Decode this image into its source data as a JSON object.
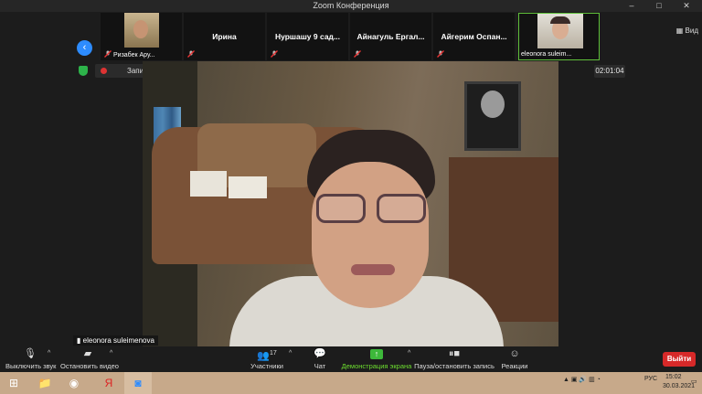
{
  "window": {
    "title": "Zoom Конференция",
    "controls": {
      "minimize": "–",
      "maximize": "□",
      "close": "✕"
    }
  },
  "gallery": {
    "view_label": "Вид",
    "tiles": [
      {
        "name": "Ризабек Ару...",
        "muted": true,
        "has_video": true
      },
      {
        "name": "Ирина",
        "muted": true,
        "has_video": false
      },
      {
        "name": "Нуршашу 9 сад...",
        "muted": true,
        "has_video": false
      },
      {
        "name": "Айнагуль Ергал...",
        "muted": true,
        "has_video": false
      },
      {
        "name": "Айгерим Оспан...",
        "muted": true,
        "has_video": false
      },
      {
        "name": "eleonora suleim...",
        "muted": false,
        "has_video": true
      }
    ]
  },
  "recording": {
    "label": "Запись...",
    "timer": "02:01:04"
  },
  "speaker": {
    "name": "eleonora suleimenova"
  },
  "toolbar": {
    "mute": "Выключить звук",
    "video": "Остановить видео",
    "participants": "Участники",
    "participants_count": "17",
    "chat": "Чат",
    "share": "Демонстрация экрана",
    "record": "Пауза/остановить запись",
    "reactions": "Реакции",
    "exit": "Выйти"
  },
  "taskbar": {
    "lang": "РУС",
    "time": "15:02",
    "date": "30.03.2021"
  },
  "colors": {
    "accent_blue": "#2d8cff",
    "share_green": "#6ddf2f",
    "exit_red": "#d72929",
    "active_border": "#5fbf3a"
  }
}
